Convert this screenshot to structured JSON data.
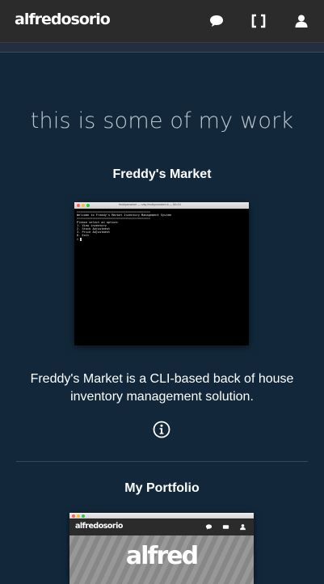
{
  "header": {
    "brand": "alfredosorio",
    "icons": [
      "chat-icon",
      "fullscreen-brackets-icon",
      "user-icon"
    ]
  },
  "main": {
    "section_title": "this is some of my work",
    "projects": [
      {
        "title": "Freddy's Market",
        "terminal_title": "freddysmarket — ruby freddysmarket.rb — 80×24",
        "terminal_lines": [
          "==========================================",
          "Welcome to Freddy's Market Inventory Management System",
          "==========================================",
          "",
          "Please select an option:",
          "1. View inventory",
          "2. Stock Adjustment",
          "3. Price Adjustment",
          "",
          "0. Exit",
          "> "
        ],
        "description": "Freddy's Market is a CLI-based back of house inventory management solution.",
        "info_icon": "info-circle-icon"
      },
      {
        "title": "My Portfolio",
        "preview_brand": "alfredosorio",
        "preview_hero": "alfred"
      }
    ]
  },
  "colors": {
    "background": "#12283a",
    "topbar": "#2b2b2b",
    "section_title": "#bcc6cf"
  }
}
